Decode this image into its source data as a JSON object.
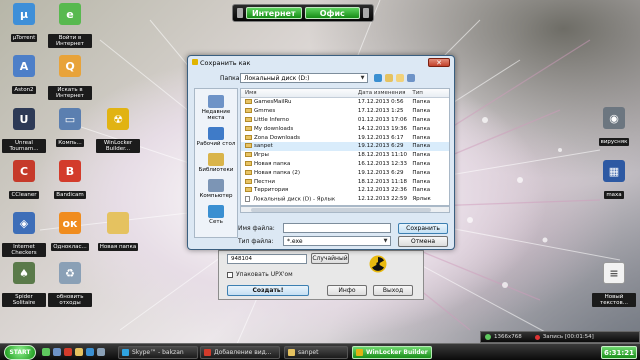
{
  "desktop": {
    "icons_left": [
      {
        "label": "µTorrent",
        "icon": "utorrent-icon",
        "color": "#3e8fd8",
        "glyph": "µ"
      },
      {
        "label": "Войти в Интернет",
        "icon": "internet-icon",
        "color": "#58b94f",
        "glyph": "e"
      },
      {
        "label": "Aston2",
        "icon": "aston-icon",
        "color": "#4d7fc8",
        "glyph": "A"
      },
      {
        "label": "Искать в Интернет",
        "icon": "search-internet-icon",
        "color": "#e8a33a",
        "glyph": "Q"
      },
      {
        "label": "Unreal Tournam...",
        "icon": "unreal-icon",
        "color": "#2d3a56",
        "glyph": "U"
      },
      {
        "label": "Компь...",
        "icon": "computer-icon",
        "color": "#5b7fb0",
        "glyph": "▭"
      },
      {
        "label": "WinLocker Builder...",
        "icon": "winlocker-icon",
        "color": "#e1b313",
        "glyph": "☢"
      },
      {
        "label": "CCleaner",
        "icon": "ccleaner-icon",
        "color": "#c63a2a",
        "glyph": "C"
      },
      {
        "label": "Bandicam",
        "icon": "bandicam-icon",
        "color": "#d33b2b",
        "glyph": "B"
      },
      {
        "label": "Internet Checkers",
        "icon": "checkers-icon",
        "color": "#3d6eb8",
        "glyph": "◈"
      },
      {
        "label": "Одноклас...",
        "icon": "odnoklassniki-icon",
        "color": "#f08c1e",
        "glyph": "ок"
      },
      {
        "label": "Новая папка",
        "icon": "folder-icon",
        "color": "#e5c260",
        "glyph": ""
      },
      {
        "label": "Spider Solitaire",
        "icon": "spider-solitaire-icon",
        "color": "#5a7a4a",
        "glyph": "♠"
      },
      {
        "label": "обновить отходы",
        "icon": "recycle-bin-icon",
        "color": "#8aa0b6",
        "glyph": "♻"
      }
    ],
    "icons_right": [
      {
        "label": "вирусняк",
        "icon": "virus-icon",
        "color": "#6c7680",
        "glyph": "◉"
      },
      {
        "label": "maxa",
        "icon": "maxa-icon",
        "color": "#2d59a3",
        "glyph": "▦"
      },
      {
        "label": "Новый текстов...",
        "icon": "text-document-icon",
        "color": "#f2f2f2",
        "glyph": "≡"
      }
    ]
  },
  "topbar": {
    "internet": "Интернет",
    "office": "Офис"
  },
  "dialog": {
    "title": "Сохранить как",
    "folder_label": "Папка:",
    "folder_value": "Локальный диск (D:)",
    "places": [
      {
        "label": "Недавние места",
        "icon": "recent-places-icon",
        "color": "#6e93c7"
      },
      {
        "label": "Рабочий стол",
        "icon": "desktop-place-icon",
        "color": "#3f7bc8"
      },
      {
        "label": "Библиотеки",
        "icon": "libraries-icon",
        "color": "#d9b44a"
      },
      {
        "label": "Компьютер",
        "icon": "computer-place-icon",
        "color": "#7c95b5"
      },
      {
        "label": "Сеть",
        "icon": "network-icon",
        "color": "#3a8fd1"
      }
    ],
    "columns": {
      "name": "Имя",
      "date": "Дата изменения",
      "type": "Тип"
    },
    "files": [
      {
        "name": "GamesMailRu",
        "date": "17.12.2013 0:56",
        "type": "Папка",
        "kind": "folder"
      },
      {
        "name": "Gmmes",
        "date": "17.12.2013 1:25",
        "type": "Папка",
        "kind": "folder"
      },
      {
        "name": "Little Inferno",
        "date": "01.12.2013 17:06",
        "type": "Папка",
        "kind": "folder"
      },
      {
        "name": "My downloads",
        "date": "14.12.2013 19:36",
        "type": "Папка",
        "kind": "folder"
      },
      {
        "name": "Zona Downloads",
        "date": "19.12.2013 6:17",
        "type": "Папка",
        "kind": "folder"
      },
      {
        "name": "sanpet",
        "date": "19.12.2013 6:29",
        "type": "Папка",
        "kind": "folder",
        "selected": true
      },
      {
        "name": "Игры",
        "date": "18.12.2013 11:10",
        "type": "Папка",
        "kind": "folder"
      },
      {
        "name": "Новая папка",
        "date": "16.12.2013 12:33",
        "type": "Папка",
        "kind": "folder"
      },
      {
        "name": "Новая папка (2)",
        "date": "19.12.2013 6:29",
        "type": "Папка",
        "kind": "folder"
      },
      {
        "name": "Пестни",
        "date": "18.12.2013 11:18",
        "type": "Папка",
        "kind": "folder"
      },
      {
        "name": "Территория",
        "date": "12.12.2013 22:36",
        "type": "Папка",
        "kind": "folder"
      },
      {
        "name": "Локальный диск (D) - Ярлык",
        "date": "12.12.2013 22:59",
        "type": "Ярлык",
        "kind": "shortcut"
      }
    ],
    "filename_label": "Имя файла:",
    "filename_value": "",
    "filetype_label": "Тип файла:",
    "filetype_value": "*.exe",
    "save_button": "Сохранить",
    "cancel_button": "Отмена"
  },
  "builder": {
    "field_text": "948104",
    "random_button": "Случайный",
    "upx_label": "Упаковать UPX'ом",
    "create_button": "Создать!",
    "info_button": "Инфо",
    "exit_button": "Выход"
  },
  "tray": {
    "resolution": "1366x768",
    "recording": "Запись [00:01:54]"
  },
  "taskbar": {
    "start": "START",
    "tasks": [
      {
        "label": "Skype™ - bakzan",
        "color": "#2fa3e0",
        "active": false
      },
      {
        "label": "Добавление вид...",
        "color": "#d33b2b",
        "active": false
      },
      {
        "label": "sanpet",
        "color": "#e5c260",
        "active": false
      },
      {
        "label": "WinLocker Builder",
        "color": "#e1b313",
        "active": true
      }
    ],
    "clock": "6:31:21"
  }
}
